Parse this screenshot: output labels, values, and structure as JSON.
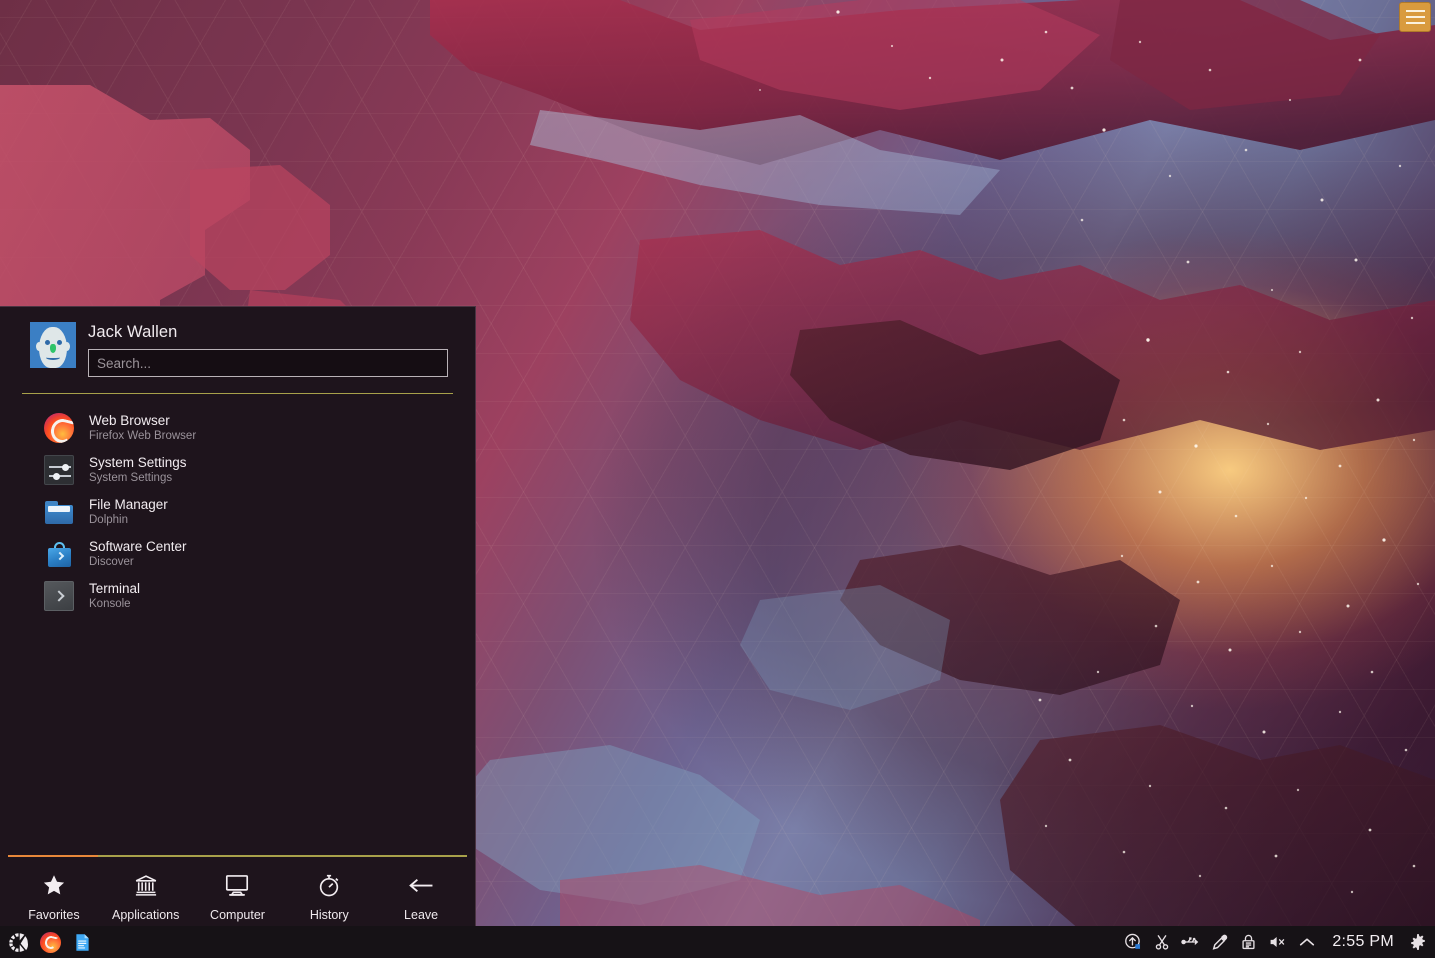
{
  "desktop": {
    "wallpaper_name": "plasma-hexagon-nebula",
    "accent_color": "#e8883a",
    "panel_bg": "#1e141c",
    "taskbar_bg": "#161216"
  },
  "toolbox": {
    "name": "desktop-toolbox",
    "tooltip": "Desktop Toolbox"
  },
  "kickoff": {
    "user": {
      "name": "Jack Wallen",
      "avatar_alt": "user-avatar"
    },
    "search": {
      "placeholder": "Search...",
      "value": ""
    },
    "favorites": [
      {
        "title": "Web Browser",
        "subtitle": "Firefox Web Browser",
        "icon": "firefox-icon"
      },
      {
        "title": "System Settings",
        "subtitle": "System Settings",
        "icon": "settings-icon"
      },
      {
        "title": "File Manager",
        "subtitle": "Dolphin",
        "icon": "folder-icon"
      },
      {
        "title": "Software Center",
        "subtitle": "Discover",
        "icon": "discover-icon"
      },
      {
        "title": "Terminal",
        "subtitle": "Konsole",
        "icon": "konsole-icon"
      }
    ],
    "tabs": [
      {
        "label": "Favorites",
        "icon": "star-icon",
        "active": true
      },
      {
        "label": "Applications",
        "icon": "bank-icon",
        "active": false
      },
      {
        "label": "Computer",
        "icon": "monitor-icon",
        "active": false
      },
      {
        "label": "History",
        "icon": "stopwatch-icon",
        "active": false
      },
      {
        "label": "Leave",
        "icon": "arrow-left-icon",
        "active": false
      }
    ]
  },
  "taskbar": {
    "launchers": [
      {
        "name": "kde-launcher-icon",
        "label": "Application Launcher"
      },
      {
        "name": "firefox-task-icon",
        "label": "Firefox"
      },
      {
        "name": "text-editor-task-icon",
        "label": "Text Editor"
      }
    ],
    "tray": [
      {
        "name": "updates-icon",
        "label": "Software Updates"
      },
      {
        "name": "clipboard-icon",
        "label": "Klipper Clipboard"
      },
      {
        "name": "usb-icon",
        "label": "Removable Devices"
      },
      {
        "name": "colorpicker-icon",
        "label": "Color Picker"
      },
      {
        "name": "keys-icon",
        "label": "KDE Wallet"
      },
      {
        "name": "volume-muted-icon",
        "label": "Audio Volume (muted)"
      },
      {
        "name": "expand-tray-icon",
        "label": "Show hidden icons"
      }
    ],
    "clock": "2:55 PM",
    "settings_label": "Panel Settings"
  }
}
